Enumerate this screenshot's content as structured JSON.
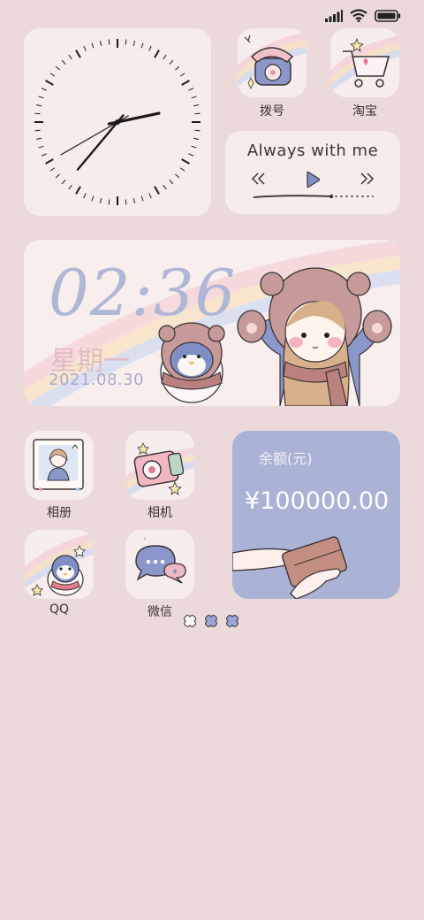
{
  "status_bar": {
    "icons": [
      "signal-icon",
      "wifi-icon",
      "battery-icon"
    ]
  },
  "apps": {
    "dial": {
      "label": "拨号",
      "icon": "telephone-icon"
    },
    "taobao": {
      "label": "淘宝",
      "icon": "shopping-cart-icon"
    },
    "album": {
      "label": "相册",
      "icon": "photo-frame-icon"
    },
    "camera": {
      "label": "相机",
      "icon": "camera-icon"
    },
    "qq": {
      "label": "QQ",
      "icon": "penguin-icon"
    },
    "wechat": {
      "label": "微信",
      "icon": "chat-bubble-icon"
    }
  },
  "music_widget": {
    "title": "Always with me",
    "controls": [
      "previous-icon",
      "play-icon",
      "next-icon"
    ]
  },
  "clock_widget": {
    "time": "02:36",
    "weekday": "星期一",
    "date": "2021.08.30"
  },
  "analog_clock": {
    "hour": 2,
    "minute": 36,
    "second": 40
  },
  "wallet_widget": {
    "title": "余额(元)",
    "amount": "¥100000.00"
  },
  "page_indicator": {
    "count": 3,
    "active_index": 0
  },
  "colors": {
    "background": "#ecdadb",
    "card": "#f7ecec",
    "wallet": "#aab2d6",
    "time_text": "#b0b6d6",
    "weekday_text": "#e0bcc2",
    "accent_blue": "#7f8fc6"
  }
}
